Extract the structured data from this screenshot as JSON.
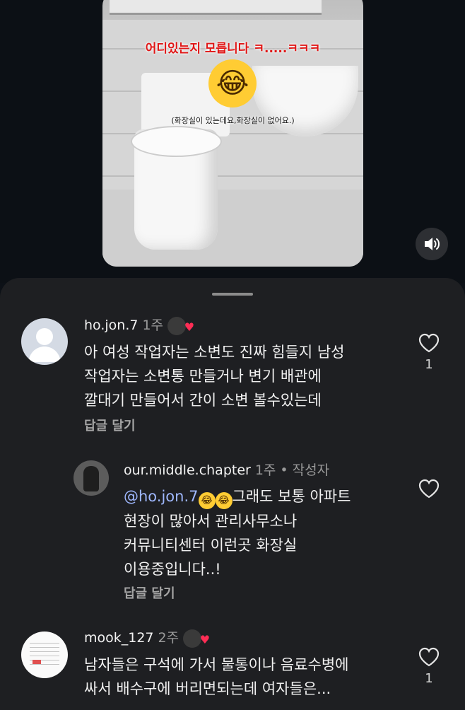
{
  "video": {
    "caption_top": "어디있는지 모릅니다 ㅋ.....ㅋㅋㅋ",
    "emoji": "😂",
    "caption_sub": "(화장실이 있는데요,화장실이 없어요.)",
    "sound_icon": "speaker-icon"
  },
  "comments": [
    {
      "user": "ho.jon.7",
      "time": "1주",
      "text_lines": [
        "아 여성 작업자는 소변도 진짜 힘들지  남성",
        "작업자는  소변통 만들거나 변기 배관에",
        "깔대기 만들어서  간이 소변 볼수있는데"
      ],
      "reply_label": "답글 달기",
      "likes": "1"
    },
    {
      "user": "our.middle.chapter",
      "time": "1주",
      "author_tag": "작성자",
      "mention": "@ho.jon.7",
      "text_first": "그래도 보통 아파트",
      "text_lines": [
        "현장이 많아서 관리사무소나",
        "커뮤니티센터 이런곳 화장실",
        "이용중입니다..!"
      ],
      "reply_label": "답글 달기"
    },
    {
      "user": "mook_127",
      "time": "2주",
      "text_lines": [
        "남자들은 구석에 가서 물통이나 음료수병에",
        "싸서 배수구에 버리면되는데 여자들은..."
      ],
      "likes": "1"
    }
  ]
}
